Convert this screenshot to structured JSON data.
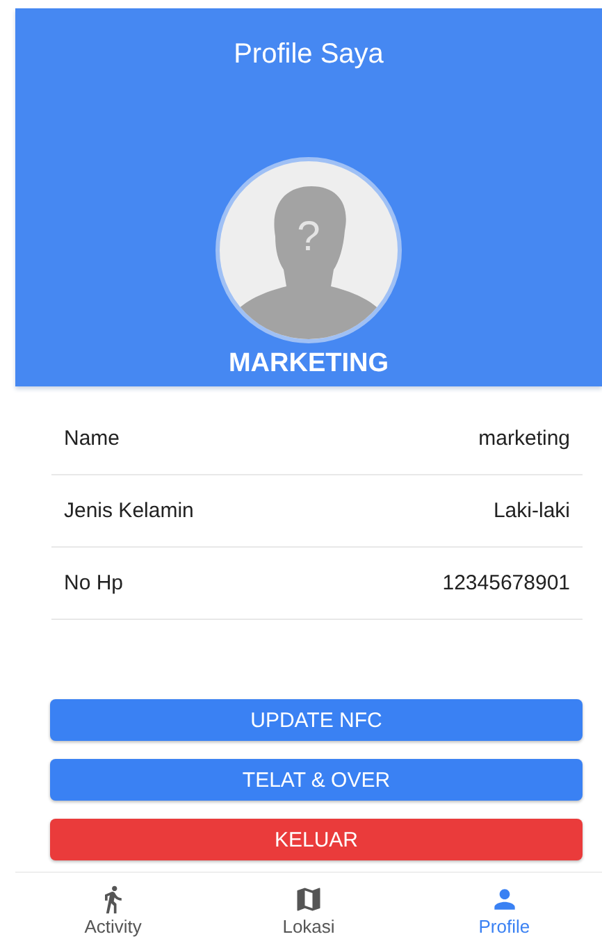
{
  "header": {
    "title": "Profile Saya",
    "avatar_mark": "?",
    "role": "MARKETING"
  },
  "fields": [
    {
      "label": "Name",
      "value": "marketing"
    },
    {
      "label": "Jenis Kelamin",
      "value": "Laki-laki"
    },
    {
      "label": "No Hp",
      "value": "12345678901"
    }
  ],
  "buttons": [
    {
      "label": "UPDATE NFC",
      "kind": "primary"
    },
    {
      "label": "TELAT & OVER",
      "kind": "primary"
    },
    {
      "label": "KELUAR",
      "kind": "danger"
    }
  ],
  "nav": [
    {
      "label": "Activity",
      "kind": "walk",
      "selected": false
    },
    {
      "label": "Lokasi",
      "kind": "map",
      "selected": false
    },
    {
      "label": "Profile",
      "kind": "person",
      "selected": true
    }
  ]
}
